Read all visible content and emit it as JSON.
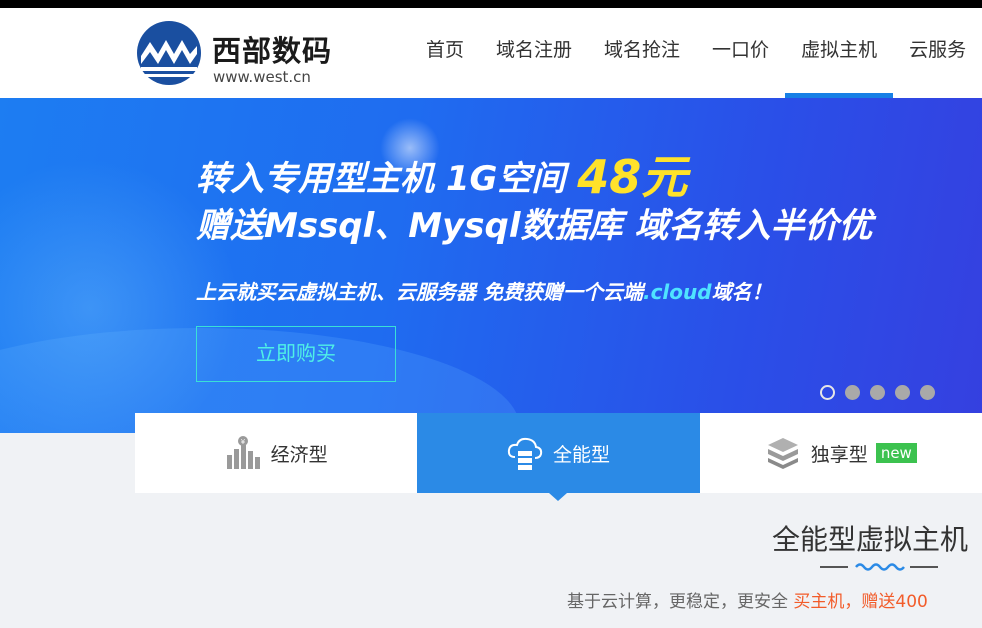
{
  "header": {
    "logo_name": "西部数码",
    "logo_url": "www.west.cn",
    "nav": [
      {
        "label": "首页",
        "active": false
      },
      {
        "label": "域名注册",
        "active": false
      },
      {
        "label": "域名抢注",
        "active": false
      },
      {
        "label": "一口价",
        "active": false
      },
      {
        "label": "虚拟主机",
        "active": true
      },
      {
        "label": "云服务",
        "active": false
      }
    ],
    "accent_color": "#1780e6"
  },
  "banner": {
    "line1_text": "转入专用型主机 1G空间 ",
    "line1_price": "48元",
    "line2": "赠送Mssql、Mysql数据库 域名转入半价优",
    "line3_text": "上云就买云虚拟主机、云服务器 免费获赠一个云端",
    "line3_highlight": ".cloud",
    "line3_end": "域名！",
    "button": "立即购买",
    "slide_count": 5,
    "active_slide": 1
  },
  "tabs": [
    {
      "label": "经济型",
      "icon": "server-coin-icon",
      "active": false
    },
    {
      "label": "全能型",
      "icon": "cloud-server-icon",
      "active": true
    },
    {
      "label": "独享型",
      "icon": "cube-stack-icon",
      "active": false,
      "badge": "new"
    }
  ],
  "section": {
    "title": "全能型虚拟主机",
    "sub_text": "基于云计算，更稳定，更安全 ",
    "sub_highlight": "买主机，赠送400"
  },
  "colors": {
    "active_tab": "#2b8ae6",
    "highlight": "#f25c2a",
    "price": "#ffe22a",
    "badge": "#3cc24f"
  }
}
